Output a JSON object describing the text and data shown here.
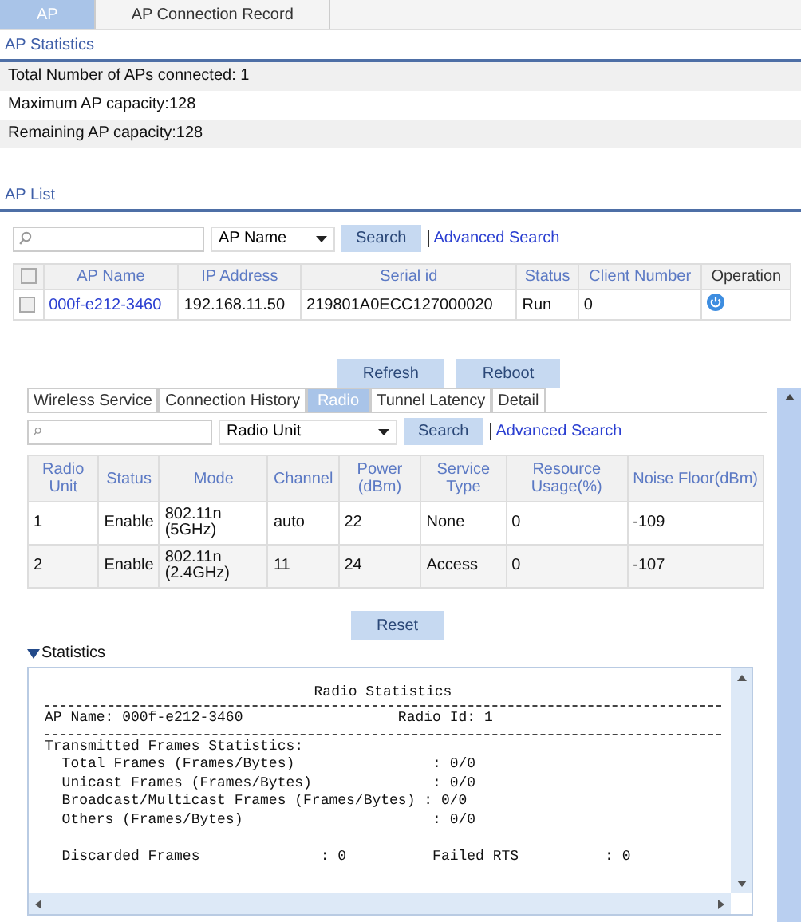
{
  "tabs": [
    {
      "label": "AP",
      "selected": true
    },
    {
      "label": "AP Connection Record",
      "selected": false
    }
  ],
  "ap_statistics": {
    "title": "AP Statistics",
    "rows": [
      "Total Number of APs connected: 1",
      "Maximum AP capacity:128",
      "Remaining AP capacity:128"
    ]
  },
  "ap_list": {
    "title": "AP List",
    "search": {
      "filter": "AP Name",
      "button": "Search",
      "link": "Advanced Search"
    },
    "table": {
      "all_checked": false,
      "columns": [
        {
          "label": "AP Name",
          "kind": "link"
        },
        {
          "label": "IP Address",
          "kind": "text"
        },
        {
          "label": "Serial id",
          "kind": "text"
        },
        {
          "label": "Status",
          "kind": "text"
        },
        {
          "label": "Client Number",
          "kind": "text"
        },
        {
          "label": "Operation",
          "kind": "action"
        }
      ],
      "rows": [
        {
          "checked": false,
          "cells": [
            "000f-e212-3460",
            "192.168.11.50",
            "219801A0ECC127000020",
            "Run",
            "0"
          ]
        }
      ]
    }
  },
  "actions": [
    "Refresh",
    "Reboot"
  ],
  "detail": {
    "tabs": [
      {
        "label": "Wireless Service",
        "selected": false
      },
      {
        "label": "Connection History",
        "selected": false
      },
      {
        "label": "Radio",
        "selected": true
      },
      {
        "label": "Tunnel Latency",
        "selected": false
      },
      {
        "label": "Detail",
        "selected": false
      }
    ],
    "search": {
      "filter": "Radio Unit",
      "button": "Search",
      "link": "Advanced Search"
    },
    "table": {
      "columns": [
        "Radio Unit",
        "Status",
        "Mode",
        "Channel",
        "Power (dBm)",
        "Service Type",
        "Resource Usage(%)",
        "Noise Floor(dBm)"
      ],
      "rows": [
        [
          "1",
          "Enable",
          "802.11n (5GHz)",
          "auto",
          "22",
          "None",
          "0",
          "-109"
        ],
        [
          "2",
          "Enable",
          "802.11n (2.4GHz)",
          "11",
          "24",
          "Access",
          "0",
          "-107"
        ]
      ]
    },
    "reset": "Reset",
    "statistics": {
      "title": "Statistics",
      "expanded": true,
      "lines": [
        {
          "kind": "title",
          "text": "Radio Statistics"
        },
        {
          "kind": "rule"
        },
        {
          "kind": "text",
          "text": "AP Name: 000f-e212-3460                  Radio Id: 1"
        },
        {
          "kind": "rule"
        },
        {
          "kind": "text",
          "text": "Transmitted Frames Statistics:"
        },
        {
          "kind": "text",
          "text": "  Total Frames (Frames/Bytes)                : 0/0"
        },
        {
          "kind": "text",
          "text": "  Unicast Frames (Frames/Bytes)              : 0/0"
        },
        {
          "kind": "text",
          "text": "  Broadcast/Multicast Frames (Frames/Bytes) : 0/0"
        },
        {
          "kind": "text",
          "text": "  Others (Frames/Bytes)                      : 0/0"
        },
        {
          "kind": "blank"
        },
        {
          "kind": "text",
          "text": "  Discarded Frames              : 0          Failed RTS          : 0"
        }
      ]
    }
  }
}
